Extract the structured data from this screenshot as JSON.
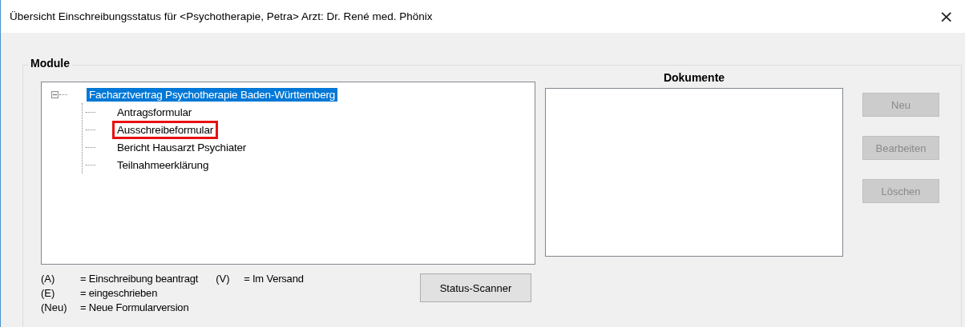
{
  "window": {
    "title": "Übersicht Einschreibungsstatus für <Psychotherapie, Petra> Arzt: Dr. René med. Phönix",
    "close": "×"
  },
  "module": {
    "title": "Module",
    "tree": [
      {
        "label": "Facharztvertrag Psychotherapie Baden-Württemberg",
        "expanded": true,
        "selected": true,
        "highlighted": false,
        "children": [
          {
            "label": "Antragsformular",
            "selected": false,
            "highlighted": false
          },
          {
            "label": "Ausschreibeformular",
            "selected": false,
            "highlighted": true
          },
          {
            "label": "Bericht Hausarzt Psychiater",
            "selected": false,
            "highlighted": false
          },
          {
            "label": "Teilnahmeerklärung",
            "selected": false,
            "highlighted": false
          }
        ]
      }
    ],
    "legend": [
      [
        {
          "code": "(A)",
          "text": "= Einschreibung beantragt"
        },
        {
          "code": "(V)",
          "text": "= Im Versand"
        }
      ],
      [
        {
          "code": "(E)",
          "text": "= eingeschrieben"
        }
      ],
      [
        {
          "code": "(Neu)",
          "text": "= Neue Formularversion"
        }
      ]
    ],
    "status_button": {
      "label": "Status-Scanner",
      "disabled": false
    }
  },
  "documents": {
    "title": "Dokumente",
    "buttons": [
      {
        "label": "Neu",
        "disabled": true
      },
      {
        "label": "Bearbeiten",
        "disabled": true
      },
      {
        "label": "Löschen",
        "disabled": true
      }
    ]
  }
}
